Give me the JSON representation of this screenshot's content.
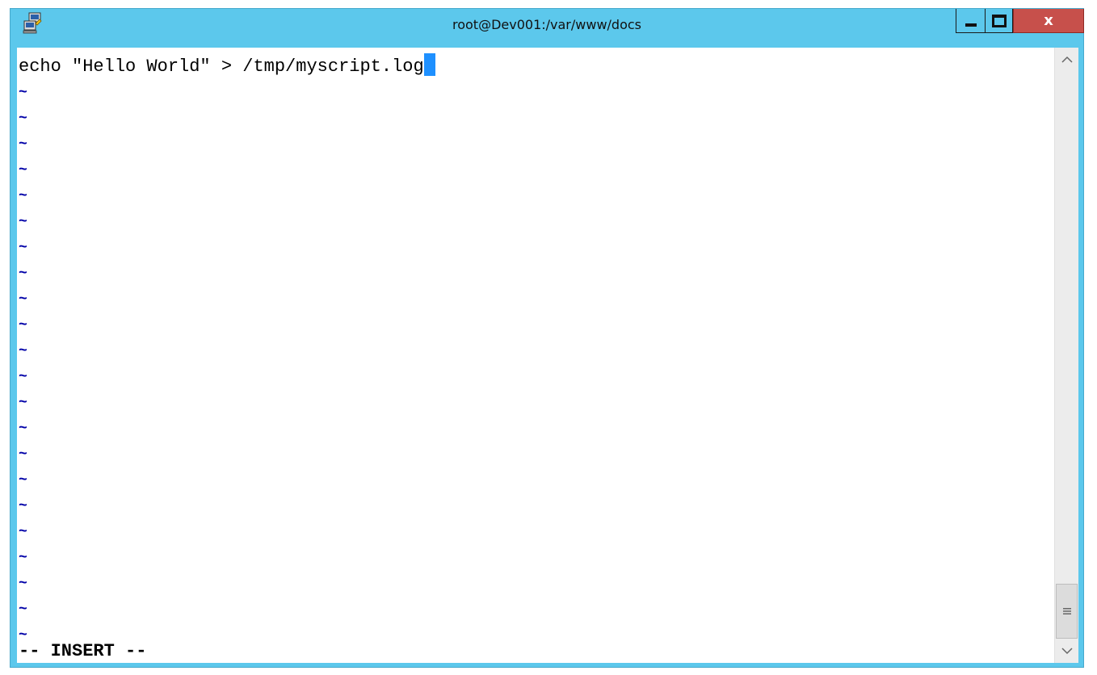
{
  "window": {
    "title": "root@Dev001:/var/www/docs",
    "icon": "putty-icon",
    "close_label": "x",
    "accent_color": "#5cc8ec",
    "close_color": "#c7504b"
  },
  "terminal": {
    "command_line": "echo \"Hello World\" > /tmp/myscript.log",
    "empty_line_marker": "~",
    "empty_line_count": 22,
    "status_line": "-- INSERT --",
    "cursor_color": "#1e90ff"
  },
  "scrollbar": {
    "up_icon": "chevron-up-icon",
    "down_icon": "chevron-down-icon",
    "thumb_icon": "grip-icon"
  }
}
